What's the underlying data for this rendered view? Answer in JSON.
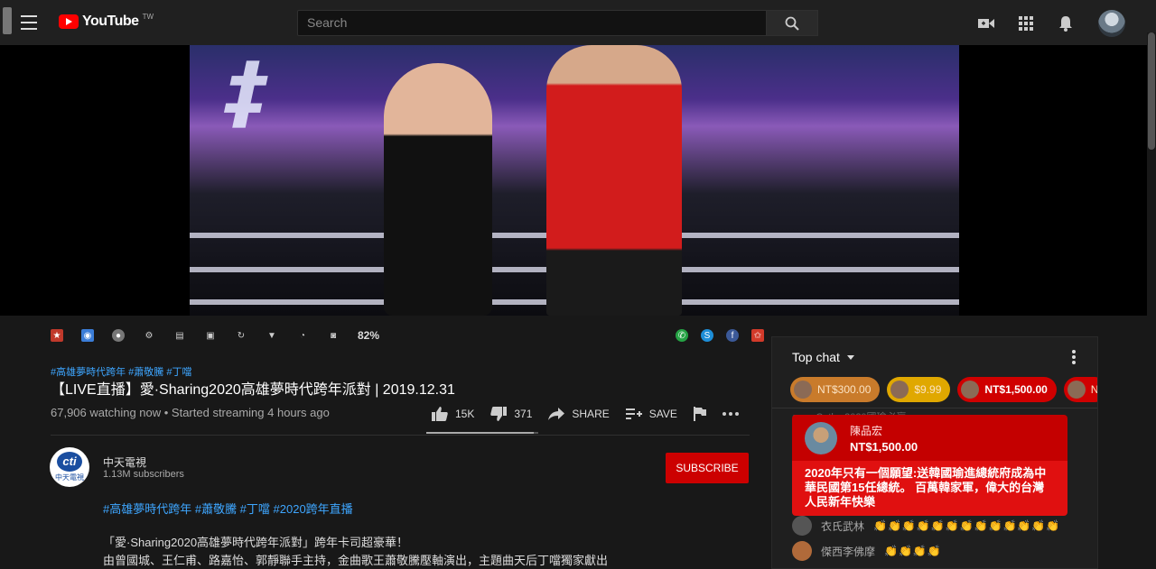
{
  "header": {
    "logo_text": "YouTube",
    "logo_region": "TW",
    "search_placeholder": "Search"
  },
  "extension_bar": {
    "percent": "82%"
  },
  "video": {
    "hashtags_top": "#高雄夢時代跨年 #蕭敬騰 #丁噹",
    "title": "【LIVE直播】愛·Sharing2020高雄夢時代跨年派對 | 2019.12.31",
    "watching": "67,906 watching now • Started streaming 4 hours ago",
    "likes": "15K",
    "dislikes": "371",
    "share_label": "SHARE",
    "save_label": "SAVE",
    "like_ratio": 0.96
  },
  "channel": {
    "name": "中天電視",
    "subscribers": "1.13M subscribers",
    "subscribe_label": "SUBSCRIBE",
    "avatar_top": "cti",
    "avatar_bottom": "中天電視"
  },
  "description": {
    "tags": "#高雄夢時代跨年 #蕭敬騰 #丁噹 #2020跨年直播",
    "line1": "「愛·Sharing2020高雄夢時代跨年派對」跨年卡司超豪華！",
    "line2": "由曾國城、王仁甫、路嘉怡、郭靜聯手主持，金曲歌王蕭敬騰壓軸演出，主題曲天后丁噹獨家獻出"
  },
  "chat": {
    "title": "Top chat",
    "ticker": [
      {
        "amount": "NT$300.00",
        "color": "#c97b2b"
      },
      {
        "amount": "$9.99",
        "color": "#e0a800"
      },
      {
        "amount": "NT$1,500.00",
        "color": "#d00000"
      },
      {
        "amount": "N",
        "color": "#d00000"
      }
    ],
    "superchat": {
      "author": "陳品宏",
      "amount": "NT$1,500.00",
      "message": "2020年只有一個願望:送韓國瑜進總統府成為中華民國第15任總統。 百萬韓家軍，偉大的台灣人民新年快樂"
    },
    "behind_text": "coco Cathy   2020國瑜必贏",
    "messages": [
      {
        "author": "衣氏武林",
        "text": "👏👏👏👏👏👏👏👏👏👏👏👏👏"
      },
      {
        "author": "傑西李佛摩",
        "text": "👏👏👏👏"
      }
    ]
  }
}
